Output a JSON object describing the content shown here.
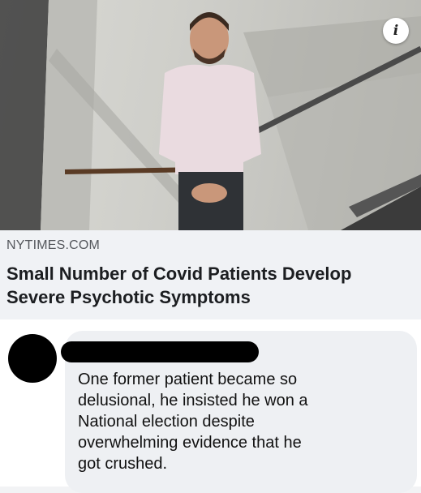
{
  "photo": {
    "info_label": "i"
  },
  "link_preview": {
    "source": "NYTIMES.COM",
    "headline": "Small Number of Covid Patients Develop Severe Psychotic Symptoms"
  },
  "comment": {
    "text": "One former patient became so\ndelusional, he insisted he won a\nNational election despite\noverwhelming evidence that he\ngot crushed."
  },
  "colors": {
    "headline": "#1c1e21",
    "source": "#55585d",
    "bubble": "#eef0f3",
    "redaction": "#000000"
  }
}
